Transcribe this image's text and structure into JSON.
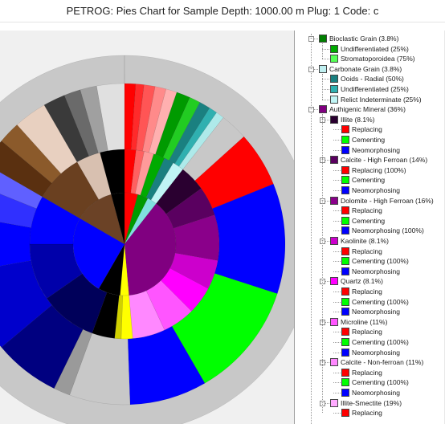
{
  "window": {
    "title": "PETROG: Pies Chart for Sample Depth: 1000.00 m   Plug: 1  Code: c"
  },
  "legend": {
    "groups": [
      {
        "label": "Bioclastic Grain (3.8%)",
        "color": "#007f00",
        "children": [
          {
            "label": "Undifferentiated (25%)",
            "color": "#00aa00"
          },
          {
            "label": "Stromatoporoidea (75%)",
            "color": "#55ff55"
          }
        ]
      },
      {
        "label": "Carbonate Grain (3.8%)",
        "color": "#bfeff0",
        "children": [
          {
            "label": "Ooids - Radial (50%)",
            "color": "#1a8080"
          },
          {
            "label": "Undifferentiated (25%)",
            "color": "#2fb0b0"
          },
          {
            "label": "Relict Indeterminate (25%)",
            "color": "#c0f5f5"
          }
        ]
      },
      {
        "label": "Authigenic Mineral (36%)",
        "color": "#800080",
        "children": [
          {
            "label": "Illite (8.1%)",
            "color": "#2a0030",
            "children": [
              {
                "label": "Replacing",
                "color": "#ff0000"
              },
              {
                "label": "Cementing",
                "color": "#00ff00"
              },
              {
                "label": "Neomorphosing",
                "color": "#0000ff"
              }
            ]
          },
          {
            "label": "Calcite - High Ferroan (14%)",
            "color": "#5a0060",
            "children": [
              {
                "label": "Replacing (100%)",
                "color": "#ff0000"
              },
              {
                "label": "Cementing",
                "color": "#00ff00"
              },
              {
                "label": "Neomorphosing",
                "color": "#0000ff"
              }
            ]
          },
          {
            "label": "Dolomite - High Ferroan (16%)",
            "color": "#8a008a",
            "children": [
              {
                "label": "Replacing",
                "color": "#ff0000"
              },
              {
                "label": "Cementing",
                "color": "#00ff00"
              },
              {
                "label": "Neomorphosing (100%)",
                "color": "#0000ff"
              }
            ]
          },
          {
            "label": "Kaolinite (8.1%)",
            "color": "#cc00cc",
            "children": [
              {
                "label": "Replacing",
                "color": "#ff0000"
              },
              {
                "label": "Cementing (100%)",
                "color": "#00ff00"
              },
              {
                "label": "Neomorphosing",
                "color": "#0000ff"
              }
            ]
          },
          {
            "label": "Quartz (8.1%)",
            "color": "#ff00ff",
            "children": [
              {
                "label": "Replacing",
                "color": "#ff0000"
              },
              {
                "label": "Cementing (100%)",
                "color": "#00ff00"
              },
              {
                "label": "Neomorphosing",
                "color": "#0000ff"
              }
            ]
          },
          {
            "label": "Microline (11%)",
            "color": "#ff55ff",
            "children": [
              {
                "label": "Replacing",
                "color": "#ff0000"
              },
              {
                "label": "Cementing (100%)",
                "color": "#00ff00"
              },
              {
                "label": "Neomorphosing",
                "color": "#0000ff"
              }
            ]
          },
          {
            "label": "Calcite - Non-ferroan (11%)",
            "color": "#ff88ff",
            "children": [
              {
                "label": "Replacing",
                "color": "#ff0000"
              },
              {
                "label": "Cementing (100%)",
                "color": "#00ff00"
              },
              {
                "label": "Neomorphosing",
                "color": "#0000ff"
              }
            ]
          },
          {
            "label": "Illite-Smectite (19%)",
            "color": "#ffaaff",
            "children": [
              {
                "label": "Replacing",
                "color": "#ff0000"
              }
            ]
          }
        ]
      }
    ]
  },
  "pie_colors": {
    "background": "#c8c8c8",
    "replacing": "#ff0000",
    "cementing": "#00ff00",
    "neomorphosing": "#0000ff"
  }
}
